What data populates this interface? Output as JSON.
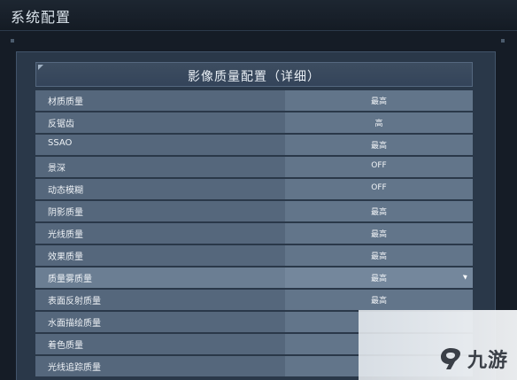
{
  "window": {
    "title": "系统配置"
  },
  "panel": {
    "title": "影像质量配置（详细）"
  },
  "settings": [
    {
      "label": "材质质量",
      "value": "最高"
    },
    {
      "label": "反锯齿",
      "value": "高"
    },
    {
      "label": "SSAO",
      "value": "最高"
    },
    {
      "label": "景深",
      "value": "OFF"
    },
    {
      "label": "动态模糊",
      "value": "OFF"
    },
    {
      "label": "阴影质量",
      "value": "最高"
    },
    {
      "label": "光线质量",
      "value": "最高"
    },
    {
      "label": "效果质量",
      "value": "最高"
    },
    {
      "label": "质量雾质量",
      "value": "最高"
    },
    {
      "label": "表面反射质量",
      "value": "最高"
    },
    {
      "label": "水面描绘质量",
      "value": ""
    },
    {
      "label": "着色质量",
      "value": ""
    },
    {
      "label": "光线追踪质量",
      "value": ""
    }
  ],
  "selected_index": 8,
  "watermark": {
    "text": "九游",
    "icon": "jiuyou-logo-icon"
  },
  "colors": {
    "background": "#151c26",
    "panel": "#2a3849",
    "row": "#55677c",
    "row_value": "#62758a",
    "selected_row": "#6b7e93"
  }
}
